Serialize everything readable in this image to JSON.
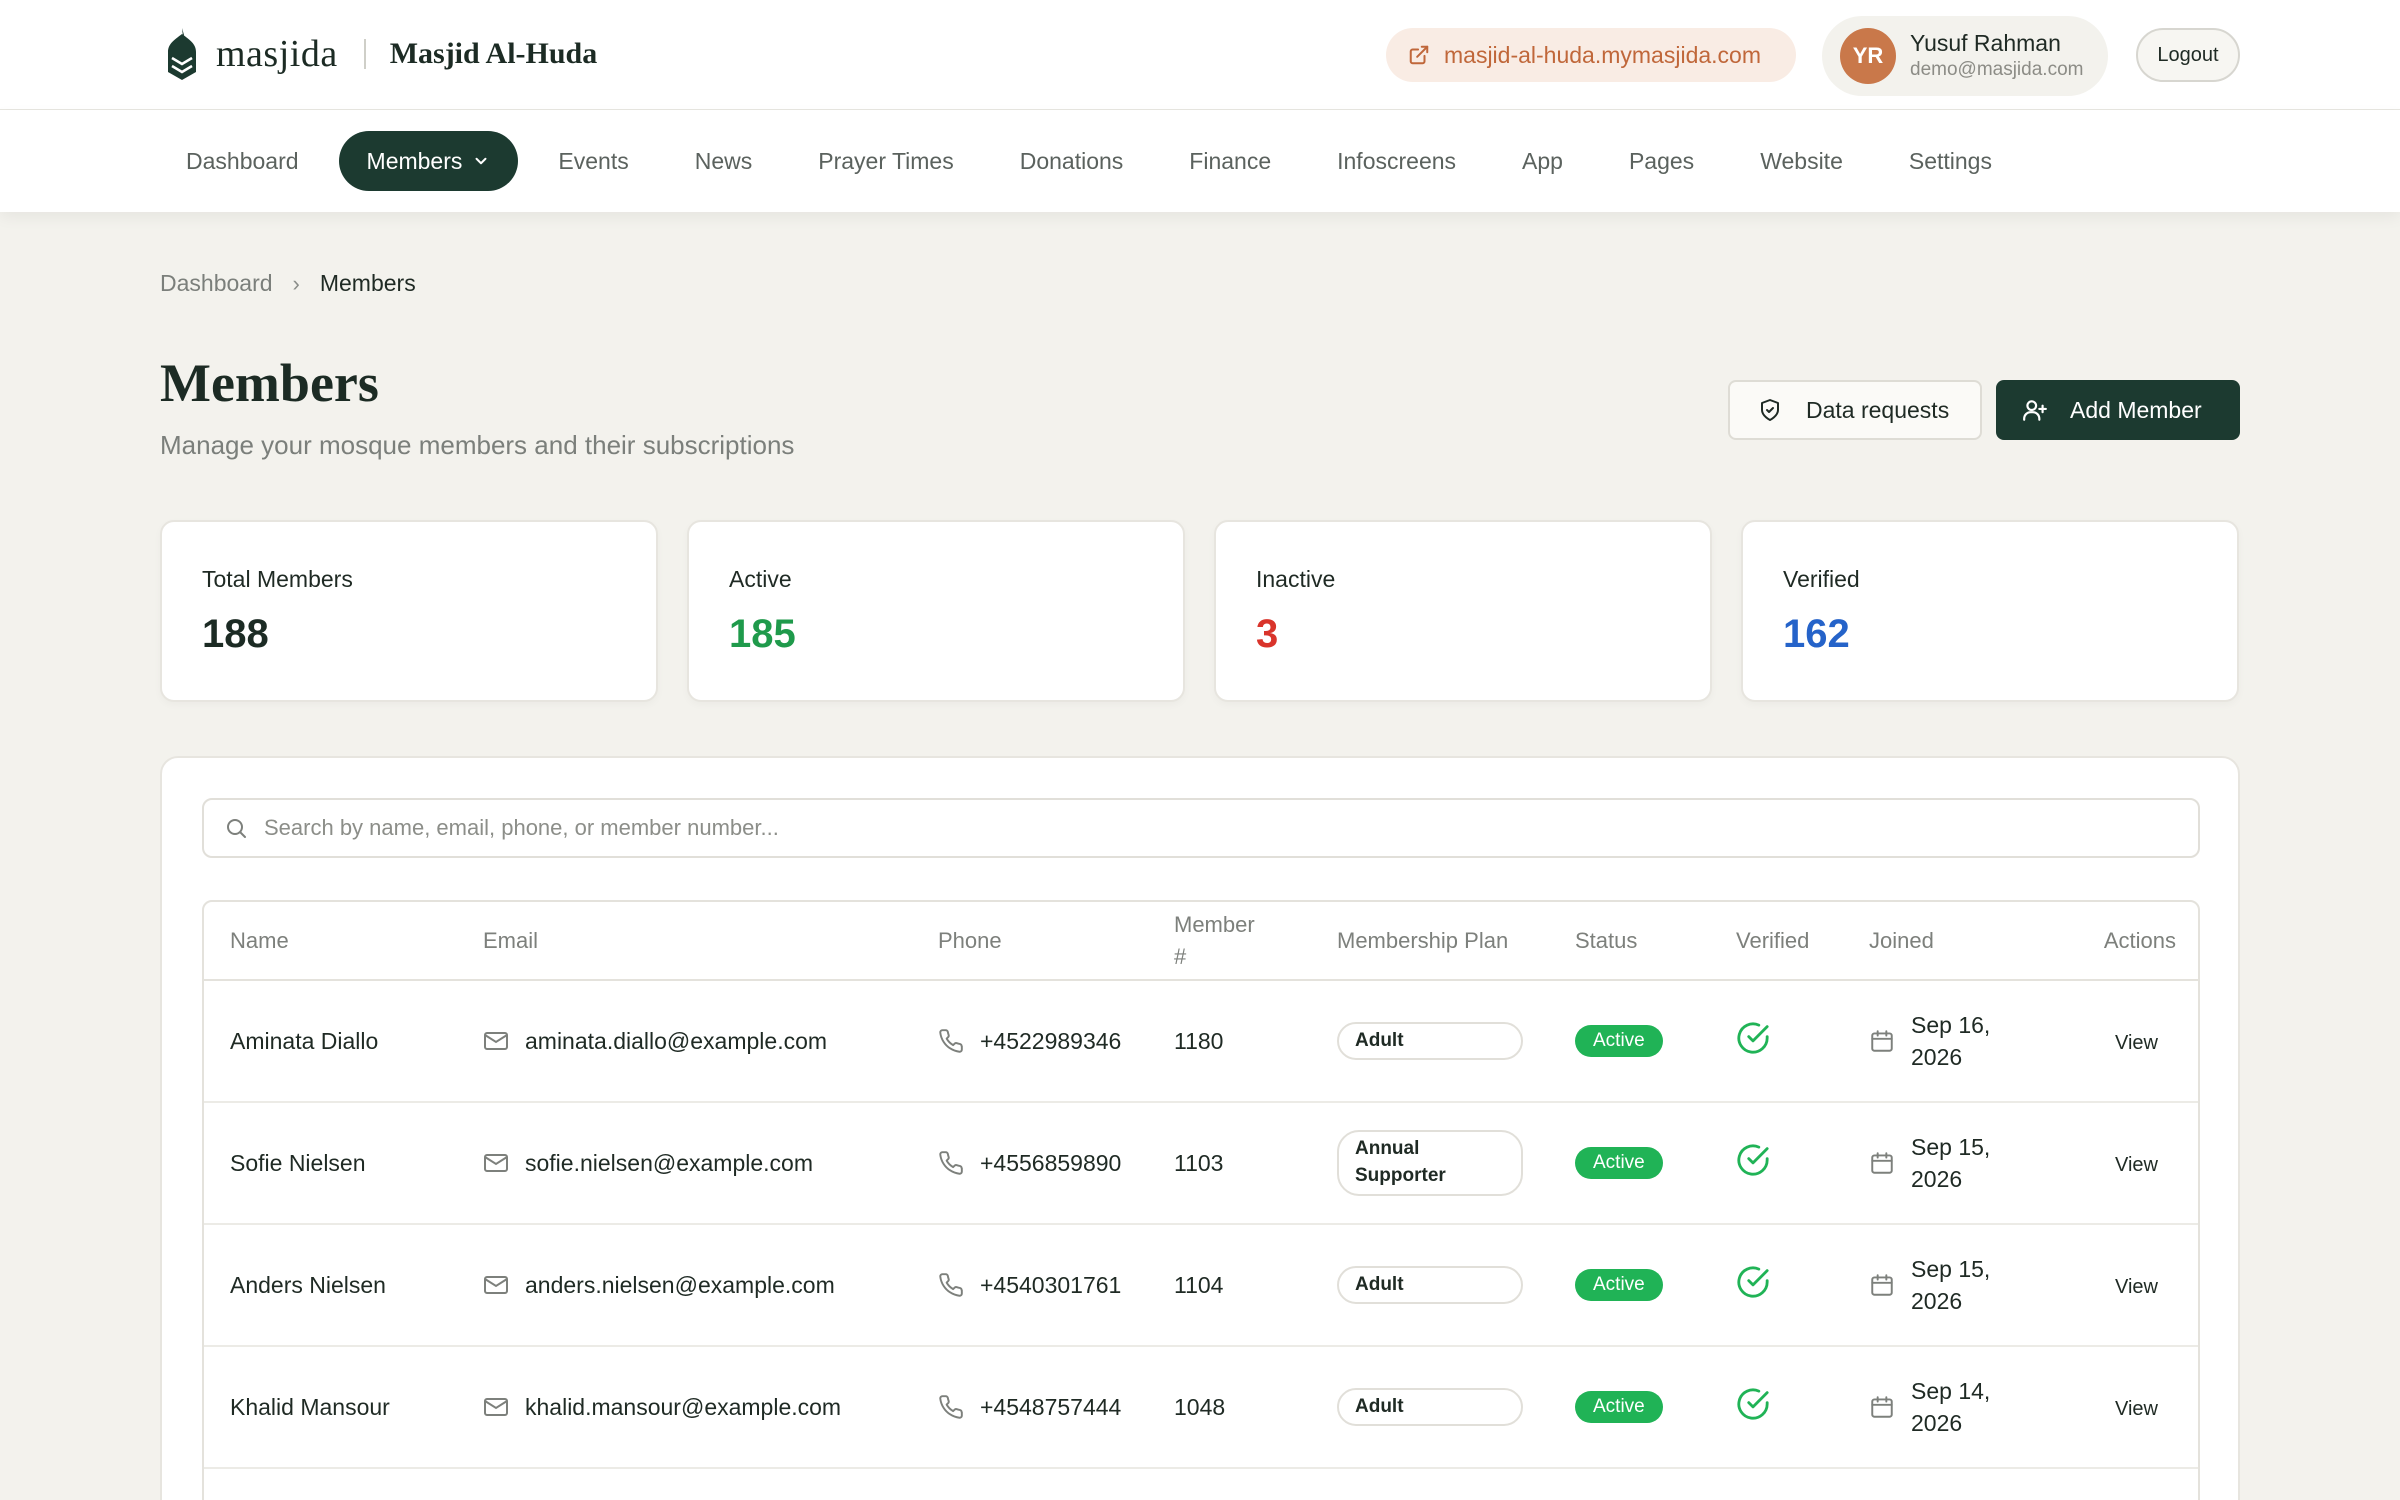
{
  "brand": {
    "name": "masjida",
    "mosque": "Masjid Al-Huda"
  },
  "header": {
    "site_link": "masjid-al-huda.mymasjida.com",
    "user": {
      "initials": "YR",
      "name": "Yusuf Rahman",
      "email": "demo@masjida.com"
    },
    "logout_label": "Logout",
    "colors": {
      "avatar": "#c9784a",
      "link": "#c0673a"
    }
  },
  "nav": {
    "items": [
      {
        "label": "Dashboard"
      },
      {
        "label": "Members",
        "active": true
      },
      {
        "label": "Events"
      },
      {
        "label": "News"
      },
      {
        "label": "Prayer Times"
      },
      {
        "label": "Donations"
      },
      {
        "label": "Finance"
      },
      {
        "label": "Infoscreens"
      },
      {
        "label": "App"
      },
      {
        "label": "Pages"
      },
      {
        "label": "Website"
      },
      {
        "label": "Settings"
      }
    ],
    "active_color": "#1c3a30"
  },
  "breadcrumb": {
    "home": "Dashboard",
    "current": "Members"
  },
  "page": {
    "title": "Members",
    "subtitle": "Manage your mosque members and their subscriptions",
    "data_requests_label": "Data requests",
    "add_member_label": "Add Member"
  },
  "stats": [
    {
      "label": "Total Members",
      "value": "188",
      "color": "#1c2b24"
    },
    {
      "label": "Active",
      "value": "185",
      "color": "#1f9a4b"
    },
    {
      "label": "Inactive",
      "value": "3",
      "color": "#d9342b"
    },
    {
      "label": "Verified",
      "value": "162",
      "color": "#2563c9"
    }
  ],
  "search": {
    "placeholder": "Search by name, email, phone, or member number..."
  },
  "table": {
    "headers": {
      "name": "Name",
      "email": "Email",
      "phone": "Phone",
      "member": "Member #",
      "plan": "Membership Plan",
      "status": "Status",
      "verified": "Verified",
      "joined": "Joined",
      "actions": "Actions"
    },
    "rows": [
      {
        "name": "Aminata Diallo",
        "email": "aminata.diallo@example.com",
        "phone": "+4522989346",
        "member": "1180",
        "plan": "Adult",
        "status": "Active",
        "joined": "Sep 16, 2026",
        "action": "View"
      },
      {
        "name": "Sofie Nielsen",
        "email": "sofie.nielsen@example.com",
        "phone": "+4556859890",
        "member": "1103",
        "plan": "Annual Supporter",
        "status": "Active",
        "joined": "Sep 15, 2026",
        "action": "View"
      },
      {
        "name": "Anders Nielsen",
        "email": "anders.nielsen@example.com",
        "phone": "+4540301761",
        "member": "1104",
        "plan": "Adult",
        "status": "Active",
        "joined": "Sep 15, 2026",
        "action": "View"
      },
      {
        "name": "Khalid Mansour",
        "email": "khalid.mansour@example.com",
        "phone": "+4548757444",
        "member": "1048",
        "plan": "Adult",
        "status": "Active",
        "joined": "Sep 14, 2026",
        "action": "View"
      }
    ],
    "status_color": "#20b356",
    "verified_color": "#20b356"
  }
}
